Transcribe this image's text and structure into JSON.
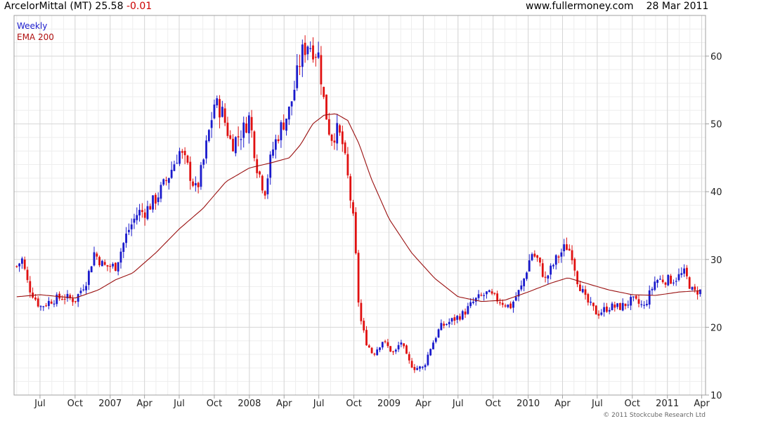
{
  "header": {
    "symbol": "ArcelorMittal (MT)",
    "price": "25.58",
    "change": "-0.01",
    "site": "www.fullermoney.com",
    "date": "28 Mar 2011"
  },
  "legend": {
    "weekly": "Weekly",
    "ema": "EMA 200"
  },
  "copyright": "© 2011 Stockcube Research Ltd",
  "colors": {
    "up": "#1a1acc",
    "down": "#e01010",
    "ema": "#9a1010",
    "grid": "#d6d6d6",
    "border": "#a0a0a0"
  },
  "chart_data": {
    "type": "candlestick",
    "title": "ArcelorMittal (MT) 25.58 -0.01",
    "interval": "Weekly",
    "ylim": [
      10,
      66
    ],
    "y_ticks": [
      10,
      20,
      30,
      40,
      50,
      60
    ],
    "y_axis_side": "right",
    "x_tick_labels": [
      "Jul",
      "Oct",
      "2007",
      "Apr",
      "Jul",
      "Oct",
      "2008",
      "Apr",
      "Jul",
      "Oct",
      "2009",
      "Apr",
      "Jul",
      "Oct",
      "2010",
      "Apr",
      "Jul",
      "Oct",
      "2011",
      "Apr"
    ],
    "x_tick_dates": [
      "2006-07",
      "2006-10",
      "2007-01",
      "2007-04",
      "2007-07",
      "2007-10",
      "2008-01",
      "2008-04",
      "2008-07",
      "2008-10",
      "2009-01",
      "2009-04",
      "2009-07",
      "2009-10",
      "2010-01",
      "2010-04",
      "2010-07",
      "2010-10",
      "2011-01",
      "2011-04"
    ],
    "price_path": [
      [
        "2006-05-01",
        29
      ],
      [
        "2006-05-15",
        30
      ],
      [
        "2006-06-01",
        26
      ],
      [
        "2006-07-01",
        23
      ],
      [
        "2006-08-01",
        24
      ],
      [
        "2006-09-01",
        24.5
      ],
      [
        "2006-10-01",
        24
      ],
      [
        "2006-11-01",
        27
      ],
      [
        "2006-11-20",
        31
      ],
      [
        "2006-12-15",
        29
      ],
      [
        "2007-01-01",
        29
      ],
      [
        "2007-01-15",
        29
      ],
      [
        "2007-02-15",
        34
      ],
      [
        "2007-03-15",
        37
      ],
      [
        "2007-04-01",
        37
      ],
      [
        "2007-05-01",
        39
      ],
      [
        "2007-06-01",
        42
      ],
      [
        "2007-07-01",
        46
      ],
      [
        "2007-07-20",
        44
      ],
      [
        "2007-08-15",
        40
      ],
      [
        "2007-09-01",
        44
      ],
      [
        "2007-10-01",
        53
      ],
      [
        "2007-10-20",
        52
      ],
      [
        "2007-11-15",
        47
      ],
      [
        "2007-12-15",
        49
      ],
      [
        "2008-01-01",
        51
      ],
      [
        "2008-01-20",
        44
      ],
      [
        "2008-02-10",
        40
      ],
      [
        "2008-03-01",
        46
      ],
      [
        "2008-03-20",
        49
      ],
      [
        "2008-04-15",
        52
      ],
      [
        "2008-05-01",
        56
      ],
      [
        "2008-05-15",
        60
      ],
      [
        "2008-06-01",
        62
      ],
      [
        "2008-06-20",
        61
      ],
      [
        "2008-07-01",
        60
      ],
      [
        "2008-07-15",
        53
      ],
      [
        "2008-08-01",
        48
      ],
      [
        "2008-08-20",
        49
      ],
      [
        "2008-09-01",
        47
      ],
      [
        "2008-09-15",
        42
      ],
      [
        "2008-10-01",
        35
      ],
      [
        "2008-10-15",
        22
      ],
      [
        "2008-11-01",
        18
      ],
      [
        "2008-11-20",
        16
      ],
      [
        "2008-12-15",
        18
      ],
      [
        "2009-01-15",
        16
      ],
      [
        "2009-02-01",
        18
      ],
      [
        "2009-02-20",
        15
      ],
      [
        "2009-03-10",
        14
      ],
      [
        "2009-04-01",
        14
      ],
      [
        "2009-04-20",
        17
      ],
      [
        "2009-05-15",
        20
      ],
      [
        "2009-06-15",
        21
      ],
      [
        "2009-07-15",
        22
      ],
      [
        "2009-08-15",
        24
      ],
      [
        "2009-09-15",
        25
      ],
      [
        "2009-10-15",
        24
      ],
      [
        "2009-11-15",
        23
      ],
      [
        "2009-12-15",
        26
      ],
      [
        "2010-01-10",
        31
      ],
      [
        "2010-01-25",
        30
      ],
      [
        "2010-02-15",
        27
      ],
      [
        "2010-03-15",
        30
      ],
      [
        "2010-04-10",
        32
      ],
      [
        "2010-04-25",
        31
      ],
      [
        "2010-05-10",
        27
      ],
      [
        "2010-06-01",
        24
      ],
      [
        "2010-07-01",
        22
      ],
      [
        "2010-08-01",
        23
      ],
      [
        "2010-09-01",
        23
      ],
      [
        "2010-10-01",
        24
      ],
      [
        "2010-11-01",
        23
      ],
      [
        "2010-12-01",
        27
      ],
      [
        "2011-01-15",
        27
      ],
      [
        "2011-02-15",
        28
      ],
      [
        "2011-03-10",
        25
      ],
      [
        "2011-03-28",
        25.58
      ]
    ],
    "ema_200": [
      [
        "2006-05-01",
        24.5
      ],
      [
        "2006-07-01",
        24.8
      ],
      [
        "2006-10-01",
        24.3
      ],
      [
        "2006-12-01",
        25.5
      ],
      [
        "2007-01-15",
        27
      ],
      [
        "2007-03-01",
        28
      ],
      [
        "2007-05-01",
        31
      ],
      [
        "2007-07-01",
        34.5
      ],
      [
        "2007-09-01",
        37.5
      ],
      [
        "2007-11-01",
        41.5
      ],
      [
        "2008-01-01",
        43.5
      ],
      [
        "2008-03-01",
        44.3
      ],
      [
        "2008-04-15",
        45
      ],
      [
        "2008-05-15",
        47
      ],
      [
        "2008-06-15",
        50
      ],
      [
        "2008-07-15",
        51.3
      ],
      [
        "2008-08-15",
        51.5
      ],
      [
        "2008-09-15",
        50.5
      ],
      [
        "2008-10-15",
        47
      ],
      [
        "2008-11-15",
        42
      ],
      [
        "2009-01-01",
        36
      ],
      [
        "2009-03-01",
        31
      ],
      [
        "2009-05-01",
        27.2
      ],
      [
        "2009-07-01",
        24.5
      ],
      [
        "2009-09-01",
        23.8
      ],
      [
        "2009-11-01",
        24
      ],
      [
        "2010-01-01",
        25.2
      ],
      [
        "2010-03-01",
        26.5
      ],
      [
        "2010-04-15",
        27.3
      ],
      [
        "2010-06-01",
        26.5
      ],
      [
        "2010-08-01",
        25.5
      ],
      [
        "2010-10-01",
        24.8
      ],
      [
        "2010-12-01",
        24.7
      ],
      [
        "2011-02-01",
        25.2
      ],
      [
        "2011-03-28",
        25.4
      ]
    ]
  }
}
